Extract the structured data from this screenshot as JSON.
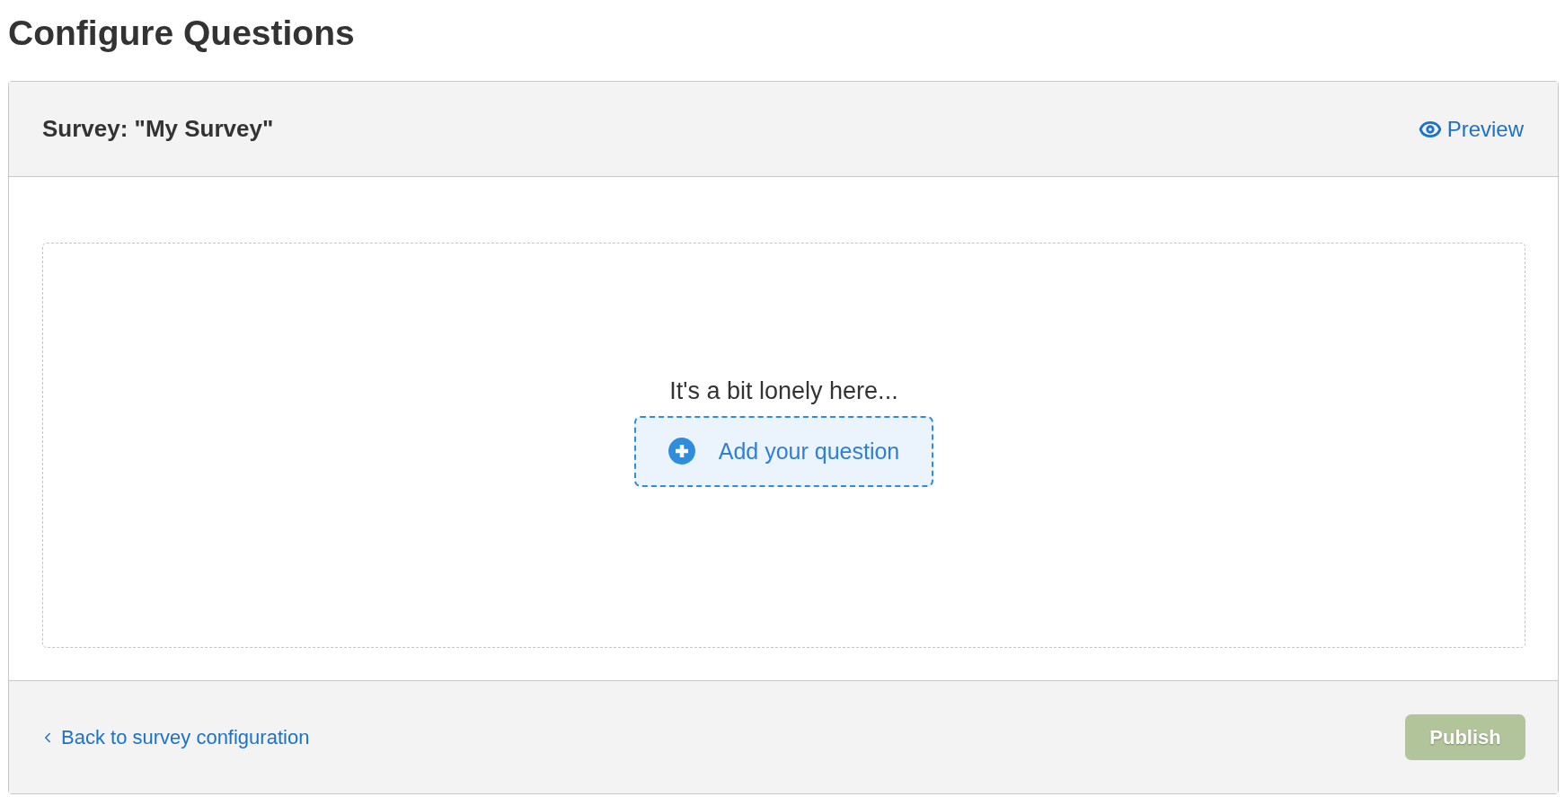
{
  "page_title": "Configure Questions",
  "card": {
    "title": "Survey: \"My Survey\"",
    "preview_link": "Preview"
  },
  "empty_state": {
    "message": "It's a bit lonely here...",
    "add_button": "Add your question"
  },
  "footer": {
    "back_link": "Back to survey configuration",
    "publish_button": {
      "label": "Publish",
      "disabled": true
    }
  }
}
